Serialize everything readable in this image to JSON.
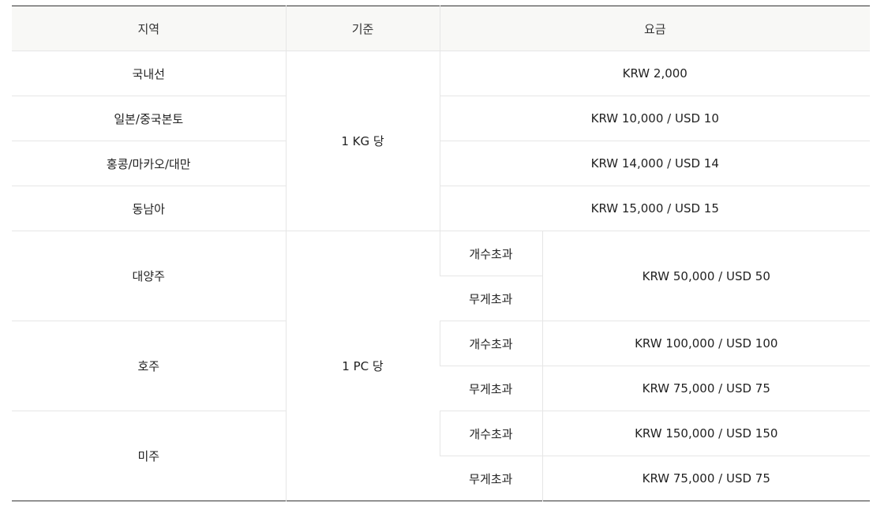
{
  "table": {
    "headers": {
      "region": "지역",
      "basis": "기준",
      "fee": "요금"
    },
    "by_weight": {
      "basis": "1 KG 당",
      "rows": [
        {
          "region": "국내선",
          "fee": "KRW 2,000"
        },
        {
          "region": "일본/중국본토",
          "fee": "KRW 10,000 / USD 10"
        },
        {
          "region": "홍콩/마카오/대만",
          "fee": "KRW 14,000 / USD 14"
        },
        {
          "region": "동남아",
          "fee": "KRW 15,000 / USD 15"
        }
      ]
    },
    "by_piece": {
      "basis": "1 PC 당",
      "groups": [
        {
          "region": "대양주",
          "rows": [
            {
              "type": "개수초과"
            },
            {
              "type": "무게초과"
            }
          ],
          "shared_fee": "KRW 50,000 / USD 50"
        },
        {
          "region": "호주",
          "rows": [
            {
              "type": "개수초과",
              "fee": "KRW 100,000 / USD 100"
            },
            {
              "type": "무게초과",
              "fee": "KRW 75,000 / USD 75"
            }
          ]
        },
        {
          "region": "미주",
          "rows": [
            {
              "type": "개수초과",
              "fee": "KRW 150,000 / USD 150"
            },
            {
              "type": "무게초과",
              "fee": "KRW 75,000 / USD 75"
            }
          ]
        }
      ]
    }
  }
}
